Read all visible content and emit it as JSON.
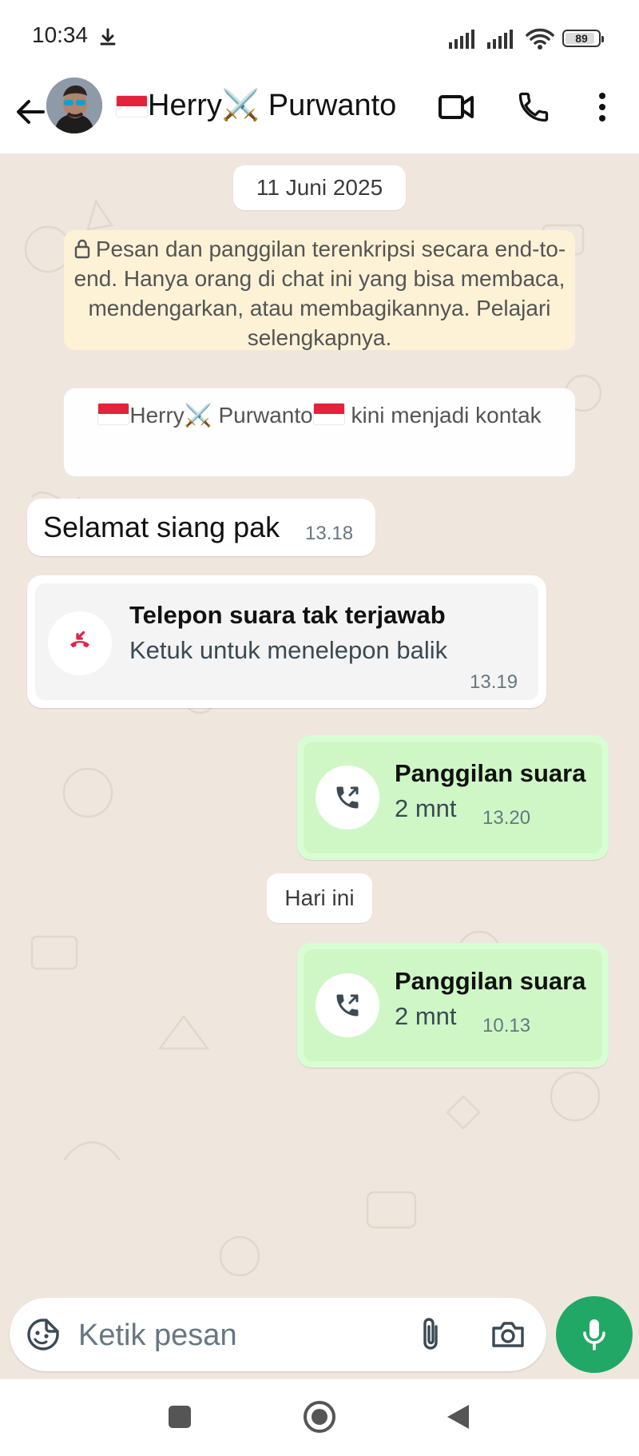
{
  "status_bar": {
    "time": "10:34",
    "battery": "89",
    "battery_level": 0.89
  },
  "header": {
    "contact_name": "🇮🇩Herry⚔️ Purwanto🇮🇩"
  },
  "chat": {
    "date_chip_1": "11 Juni 2025",
    "encryption_notice": "Pesan dan panggilan terenkripsi secara end-to-end. Hanya orang di chat ini yang bisa membaca, mendengarkan, atau membagikannya. Pelajari selengkapnya.",
    "contact_notice": {
      "name": "Herry⚔️ Purwanto",
      "suffix": " kini menjadi kontak"
    },
    "messages": [
      {
        "type": "text",
        "direction": "in",
        "text": "Selamat siang pak",
        "time": "13.18"
      },
      {
        "type": "missed_call",
        "direction": "in",
        "title": "Telepon suara tak terjawab",
        "subtitle": "Ketuk untuk menelepon balik",
        "time": "13.19"
      },
      {
        "type": "call",
        "direction": "out",
        "title": "Panggilan suara",
        "duration": "2 mnt",
        "time": "13.20"
      },
      {
        "type": "call",
        "direction": "out",
        "title": "Panggilan suara",
        "duration": "2 mnt",
        "time": "10.13"
      }
    ],
    "date_chip_2": "Hari ini"
  },
  "composer": {
    "placeholder": "Ketik pesan"
  },
  "colors": {
    "outgoing_bubble": "#d9fdd3",
    "notice_bg": "#fdf2d6",
    "mic_button": "#21a867",
    "missed_call_icon": "#e0244a",
    "chat_bg": "#efe7de"
  },
  "icons": [
    "download-icon",
    "signal-icon",
    "wifi-icon",
    "battery-icon",
    "back-arrow-icon",
    "video-call-icon",
    "voice-call-icon",
    "more-options-icon",
    "lock-icon",
    "missed-call-icon",
    "outgoing-call-icon",
    "sticker-icon",
    "attach-icon",
    "camera-icon",
    "mic-icon",
    "recents-nav-icon",
    "home-nav-icon",
    "back-nav-icon"
  ]
}
